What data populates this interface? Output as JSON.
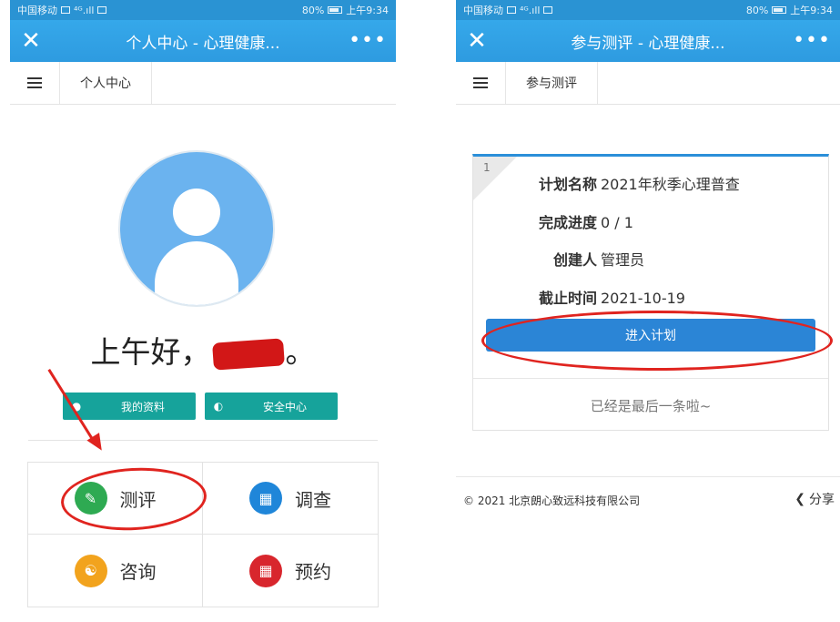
{
  "left_screen": {
    "status": {
      "carrier": "中国移动",
      "signal": "⁴ᴳ.ıll",
      "battery": "80%",
      "time": "上午9:34"
    },
    "titlebar": {
      "close": "✕",
      "title": "个人中心 - 心理健康...",
      "more": "•••"
    },
    "tabbar": {
      "tab": "个人中心"
    },
    "greeting": {
      "prefix": "上午好，",
      "suffix": "。"
    },
    "quick_buttons": [
      {
        "label": "我的资料",
        "icon": "user-icon"
      },
      {
        "label": "安全中心",
        "icon": "shield-icon"
      }
    ],
    "grid": [
      {
        "label": "测评",
        "icon": "pencil-icon",
        "color": "#2eaa52"
      },
      {
        "label": "调查",
        "icon": "bar-chart-icon",
        "color": "#1f86d9"
      },
      {
        "label": "咨询",
        "icon": "chat-bubbles-icon",
        "color": "#f2a31d"
      },
      {
        "label": "预约",
        "icon": "calendar-icon",
        "color": "#d8262d"
      }
    ]
  },
  "right_screen": {
    "status": {
      "carrier": "中国移动",
      "signal": "⁴ᴳ.ıll",
      "battery": "80%",
      "time": "上午9:34"
    },
    "titlebar": {
      "close": "✕",
      "title": "参与测评 - 心理健康...",
      "more": "•••"
    },
    "tabbar": {
      "tab": "参与测评"
    },
    "plan": {
      "index": "1",
      "rows": [
        {
          "key": "计划名称",
          "value": "2021年秋季心理普查"
        },
        {
          "key": "完成进度",
          "value": "0 / 1"
        },
        {
          "key": "创建人",
          "value": "管理员"
        },
        {
          "key": "截止时间",
          "value": "2021-10-19"
        }
      ],
      "enter_button": "进入计划",
      "end_text": "已经是最后一条啦~"
    },
    "footer": {
      "copyright": "© 2021 北京朗心致远科技有限公司",
      "share": "分享"
    }
  },
  "colors": {
    "titlebar": "#2e9be0",
    "teal_button": "#16a39b",
    "primary_button": "#2b85d6",
    "annotation_red": "#e0241f"
  }
}
